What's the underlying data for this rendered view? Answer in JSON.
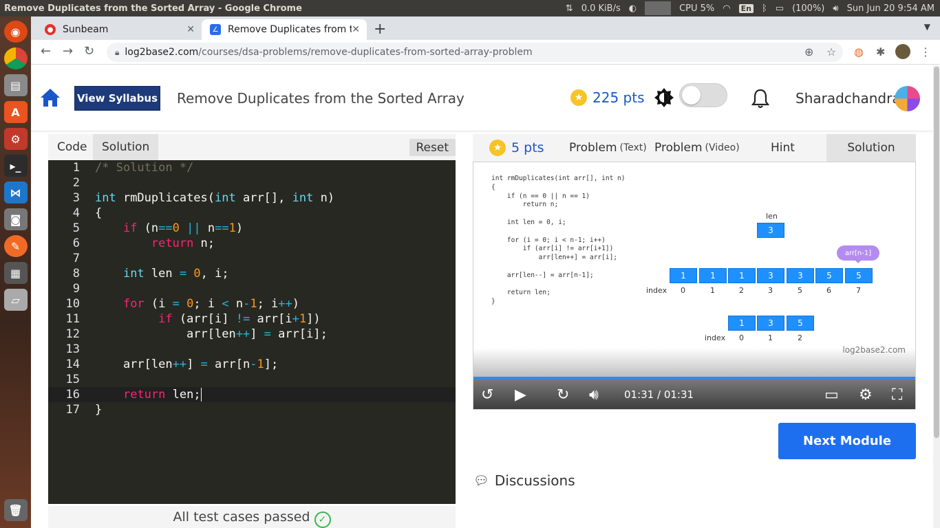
{
  "os": {
    "window_title": "Remove Duplicates from the Sorted Array - Google Chrome",
    "net_speed": "0.0 KiB/s",
    "cpu": "CPU 5%",
    "lang": "En",
    "battery": "(100%)",
    "datetime": "Sun Jun 20  9:54 AM"
  },
  "browser": {
    "tabs": [
      {
        "label": "Sunbeam"
      },
      {
        "label": "Remove Duplicates from t"
      }
    ],
    "url_host": "log2base2.com",
    "url_path": "/courses/dsa-problems/remove-duplicates-from-sorted-array-problem"
  },
  "header": {
    "syllabus_label": "View Syllabus",
    "page_title": "Remove Duplicates from the Sorted Array",
    "points": "225 pts",
    "username": "Sharadchandra"
  },
  "editor": {
    "tab_code": "Code",
    "tab_solution": "Solution",
    "reset_label": "Reset",
    "status": "All test cases passed"
  },
  "right": {
    "points": "5 pts",
    "tab_problem_text": "Problem",
    "tab_problem_text_sub": "(Text)",
    "tab_problem_video": "Problem",
    "tab_problem_video_sub": "(Video)",
    "tab_hint": "Hint",
    "tab_solution": "Solution",
    "video_code": "int rmDuplicates(int arr[], int n)\n{\n    if (n == 0 || n == 1)\n        return n;\n\n    int len = 0, i;\n\n    for (i = 0; i < n-1; i++)\n        if (arr[i] != arr[i+1])\n            arr[len++] = arr[i];\n\n    arr[len--] = arr[n-1];\n\n    return len;\n}",
    "len_label": "len",
    "len_value": "3",
    "callout": "arr[n-1]",
    "array_values": [
      "1",
      "1",
      "1",
      "3",
      "3",
      "5",
      "5"
    ],
    "array_index_label": "index",
    "array_indices": [
      "0",
      "1",
      "2",
      "3",
      "5",
      "6",
      "7"
    ],
    "result_values": [
      "1",
      "3",
      "5"
    ],
    "result_index_label": "index",
    "result_indices": [
      "0",
      "1",
      "2"
    ],
    "watermark": "log2base2.com",
    "time": "01:31 / 01:31",
    "next_label": "Next Module",
    "discussions_label": "Discussions"
  },
  "colors": {
    "accent": "#1e6ff0",
    "syllabus": "#1d3a7a",
    "editor_bg": "#272822",
    "array_box": "#1e90ff"
  }
}
